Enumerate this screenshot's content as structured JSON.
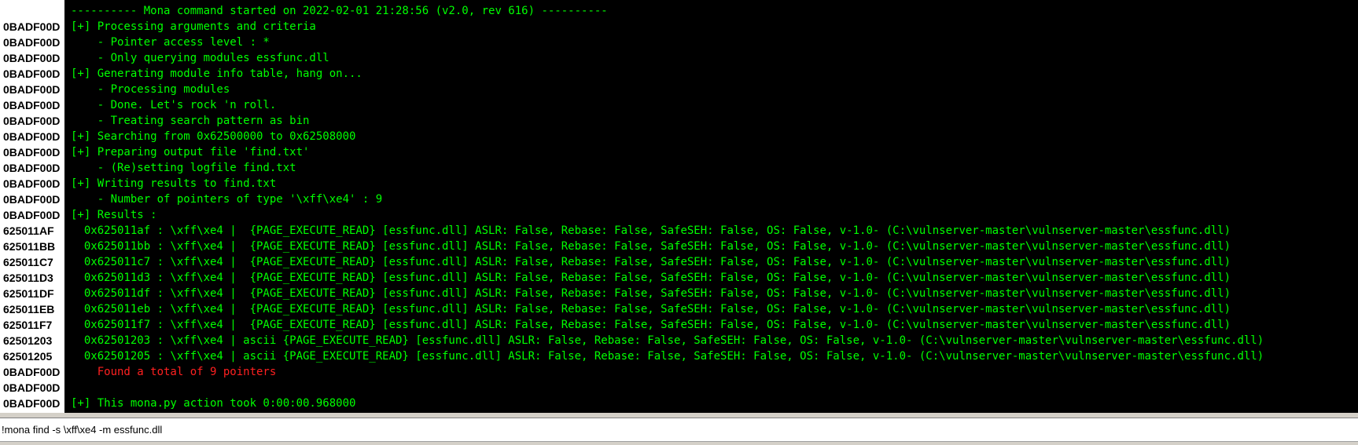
{
  "log": {
    "lines": [
      {
        "addr": "",
        "text": "---------- Mona command started on 2022-02-01 21:28:56 (v2.0, rev 616) ----------",
        "color": "green"
      },
      {
        "addr": "0BADF00D",
        "text": "[+] Processing arguments and criteria",
        "color": "green"
      },
      {
        "addr": "0BADF00D",
        "text": "    - Pointer access level : *",
        "color": "green"
      },
      {
        "addr": "0BADF00D",
        "text": "    - Only querying modules essfunc.dll",
        "color": "green"
      },
      {
        "addr": "0BADF00D",
        "text": "[+] Generating module info table, hang on...",
        "color": "green"
      },
      {
        "addr": "0BADF00D",
        "text": "    - Processing modules",
        "color": "green"
      },
      {
        "addr": "0BADF00D",
        "text": "    - Done. Let's rock 'n roll.",
        "color": "green"
      },
      {
        "addr": "0BADF00D",
        "text": "    - Treating search pattern as bin",
        "color": "green"
      },
      {
        "addr": "0BADF00D",
        "text": "[+] Searching from 0x62500000 to 0x62508000",
        "color": "green"
      },
      {
        "addr": "0BADF00D",
        "text": "[+] Preparing output file 'find.txt'",
        "color": "green"
      },
      {
        "addr": "0BADF00D",
        "text": "    - (Re)setting logfile find.txt",
        "color": "green"
      },
      {
        "addr": "0BADF00D",
        "text": "[+] Writing results to find.txt",
        "color": "green"
      },
      {
        "addr": "0BADF00D",
        "text": "    - Number of pointers of type '\\xff\\xe4' : 9",
        "color": "green"
      },
      {
        "addr": "0BADF00D",
        "text": "[+] Results :",
        "color": "green"
      },
      {
        "addr": "625011AF",
        "text": "  0x625011af : \\xff\\xe4 |  {PAGE_EXECUTE_READ} [essfunc.dll] ASLR: False, Rebase: False, SafeSEH: False, OS: False, v-1.0- (C:\\vulnserver-master\\vulnserver-master\\essfunc.dll)",
        "color": "green"
      },
      {
        "addr": "625011BB",
        "text": "  0x625011bb : \\xff\\xe4 |  {PAGE_EXECUTE_READ} [essfunc.dll] ASLR: False, Rebase: False, SafeSEH: False, OS: False, v-1.0- (C:\\vulnserver-master\\vulnserver-master\\essfunc.dll)",
        "color": "green"
      },
      {
        "addr": "625011C7",
        "text": "  0x625011c7 : \\xff\\xe4 |  {PAGE_EXECUTE_READ} [essfunc.dll] ASLR: False, Rebase: False, SafeSEH: False, OS: False, v-1.0- (C:\\vulnserver-master\\vulnserver-master\\essfunc.dll)",
        "color": "green"
      },
      {
        "addr": "625011D3",
        "text": "  0x625011d3 : \\xff\\xe4 |  {PAGE_EXECUTE_READ} [essfunc.dll] ASLR: False, Rebase: False, SafeSEH: False, OS: False, v-1.0- (C:\\vulnserver-master\\vulnserver-master\\essfunc.dll)",
        "color": "green"
      },
      {
        "addr": "625011DF",
        "text": "  0x625011df : \\xff\\xe4 |  {PAGE_EXECUTE_READ} [essfunc.dll] ASLR: False, Rebase: False, SafeSEH: False, OS: False, v-1.0- (C:\\vulnserver-master\\vulnserver-master\\essfunc.dll)",
        "color": "green"
      },
      {
        "addr": "625011EB",
        "text": "  0x625011eb : \\xff\\xe4 |  {PAGE_EXECUTE_READ} [essfunc.dll] ASLR: False, Rebase: False, SafeSEH: False, OS: False, v-1.0- (C:\\vulnserver-master\\vulnserver-master\\essfunc.dll)",
        "color": "green"
      },
      {
        "addr": "625011F7",
        "text": "  0x625011f7 : \\xff\\xe4 |  {PAGE_EXECUTE_READ} [essfunc.dll] ASLR: False, Rebase: False, SafeSEH: False, OS: False, v-1.0- (C:\\vulnserver-master\\vulnserver-master\\essfunc.dll)",
        "color": "green"
      },
      {
        "addr": "62501203",
        "text": "  0x62501203 : \\xff\\xe4 | ascii {PAGE_EXECUTE_READ} [essfunc.dll] ASLR: False, Rebase: False, SafeSEH: False, OS: False, v-1.0- (C:\\vulnserver-master\\vulnserver-master\\essfunc.dll)",
        "color": "green"
      },
      {
        "addr": "62501205",
        "text": "  0x62501205 : \\xff\\xe4 | ascii {PAGE_EXECUTE_READ} [essfunc.dll] ASLR: False, Rebase: False, SafeSEH: False, OS: False, v-1.0- (C:\\vulnserver-master\\vulnserver-master\\essfunc.dll)",
        "color": "green"
      },
      {
        "addr": "0BADF00D",
        "text": "    Found a total of 9 pointers",
        "color": "red"
      },
      {
        "addr": "0BADF00D",
        "text": "",
        "color": "green"
      },
      {
        "addr": "0BADF00D",
        "text": "[+] This mona.py action took 0:00:00.968000",
        "color": "green"
      }
    ]
  },
  "command": {
    "value": "!mona find -s \\xff\\xe4 -m essfunc.dll"
  },
  "colors": {
    "log_background": "#000000",
    "log_text": "#00ff00",
    "log_highlight": "#ff2020",
    "address_column": "#ffffff"
  }
}
